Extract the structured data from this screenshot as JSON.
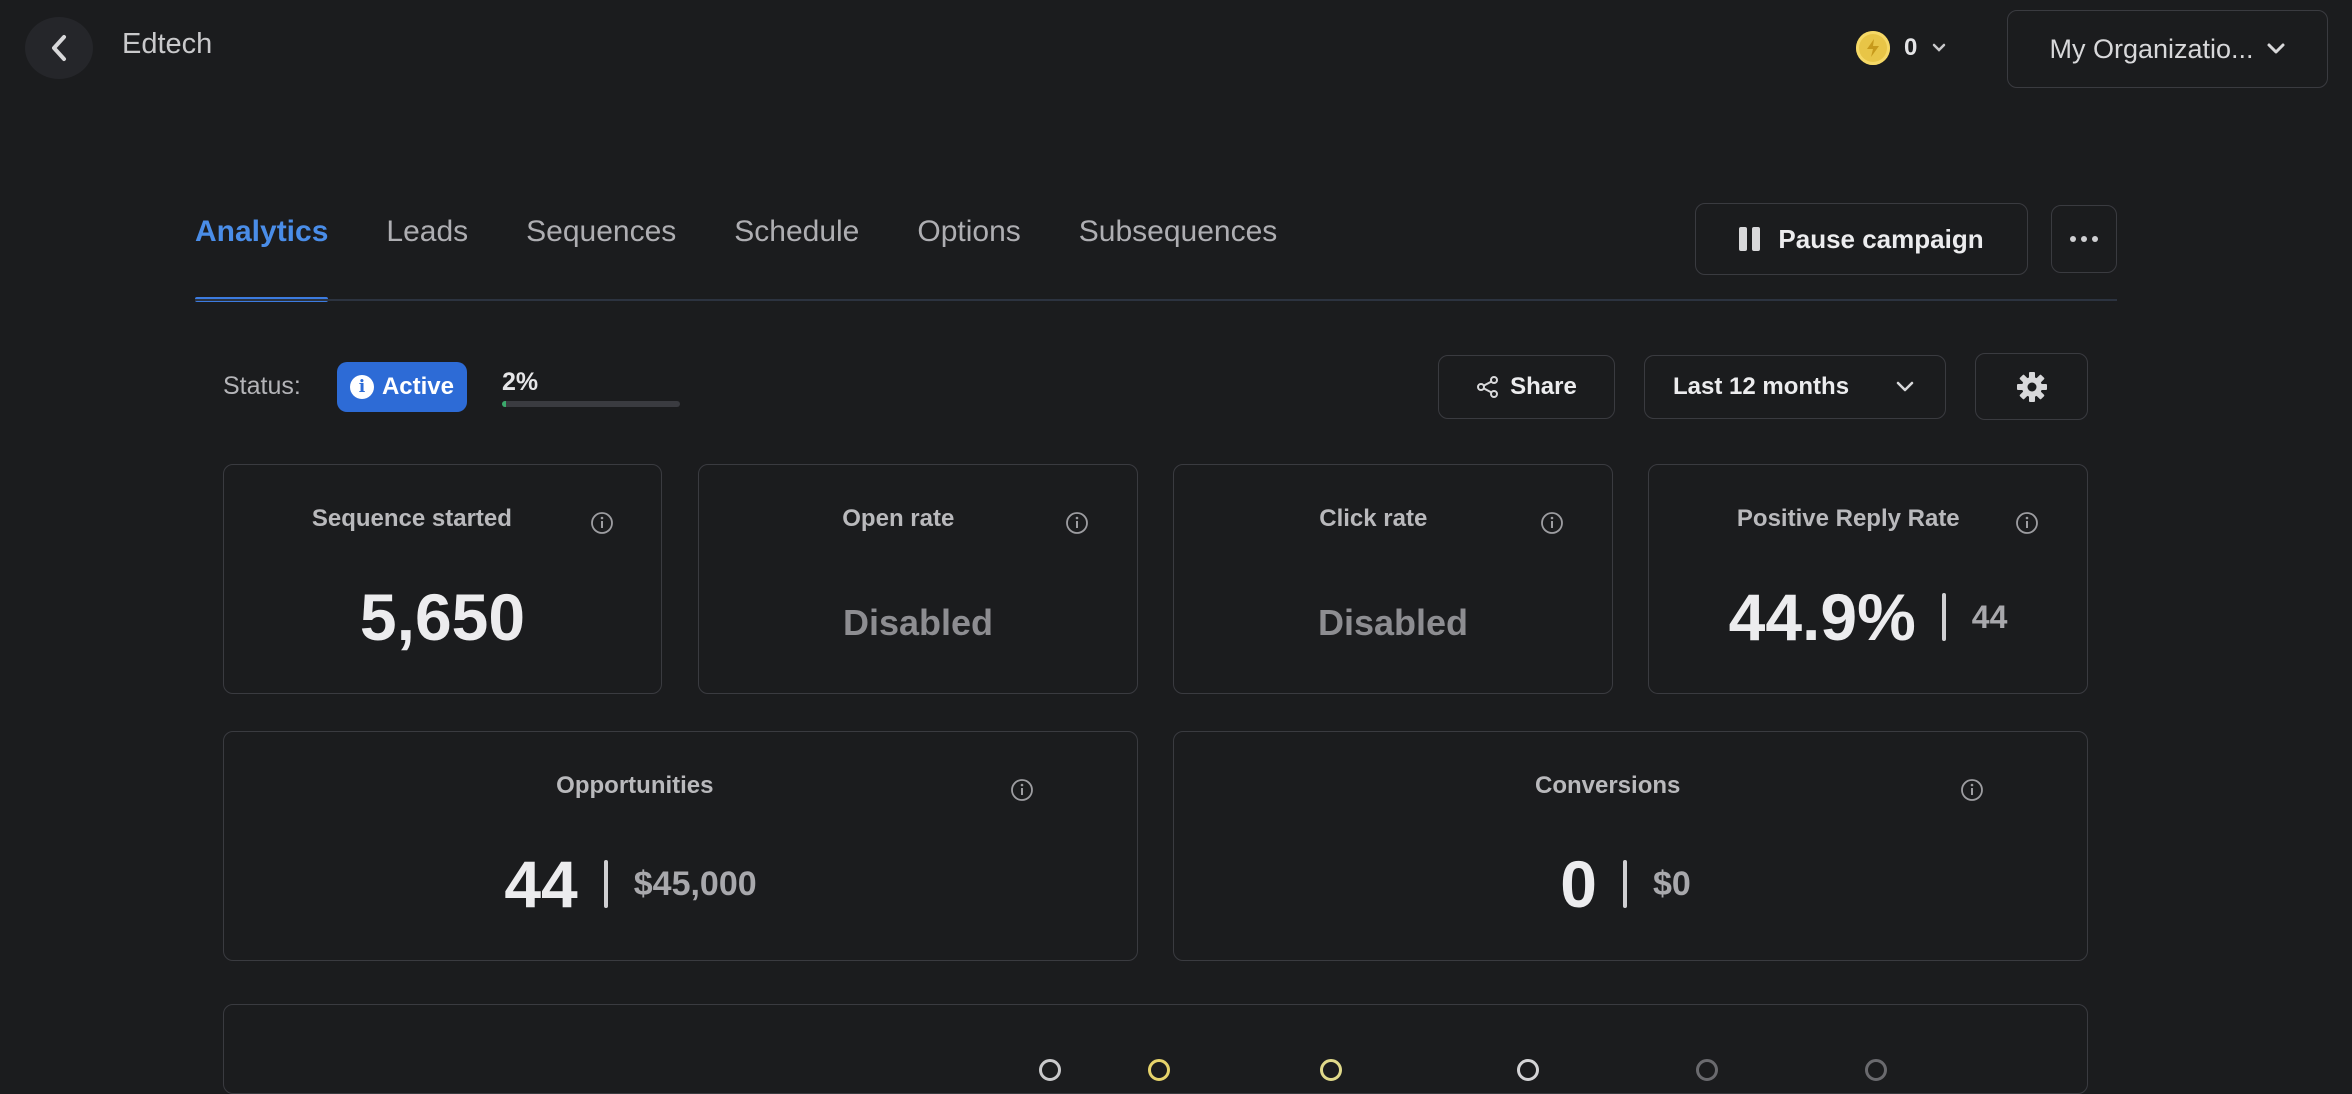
{
  "app": {
    "title": "Edtech"
  },
  "header": {
    "credits": "0",
    "organization": "My Organizatio..."
  },
  "tabs": [
    {
      "label": "Analytics",
      "active": true
    },
    {
      "label": "Leads"
    },
    {
      "label": "Sequences"
    },
    {
      "label": "Schedule"
    },
    {
      "label": "Options"
    },
    {
      "label": "Subsequences"
    }
  ],
  "actions": {
    "pause_label": "Pause campaign"
  },
  "status": {
    "label": "Status:",
    "badge": "Active",
    "progress_text": "2%",
    "progress_value": 0.02
  },
  "toolbar": {
    "share_label": "Share",
    "date_range": "Last 12 months"
  },
  "metrics": {
    "sequence_started": {
      "title": "Sequence started",
      "value": "5,650"
    },
    "open_rate": {
      "title": "Open rate",
      "value": "Disabled"
    },
    "click_rate": {
      "title": "Click rate",
      "value": "Disabled"
    },
    "positive_reply": {
      "title": "Positive Reply Rate",
      "value": "44.9%",
      "count": "44"
    },
    "opportunities": {
      "title": "Opportunities",
      "value": "44",
      "amount": "$45,000"
    },
    "conversions": {
      "title": "Conversions",
      "value": "0",
      "amount": "$0"
    }
  },
  "colors": {
    "accent": "#3c7be0",
    "active_badge": "#2d6bd6",
    "progress": "#3aa86b",
    "coin": "#e8c547"
  }
}
